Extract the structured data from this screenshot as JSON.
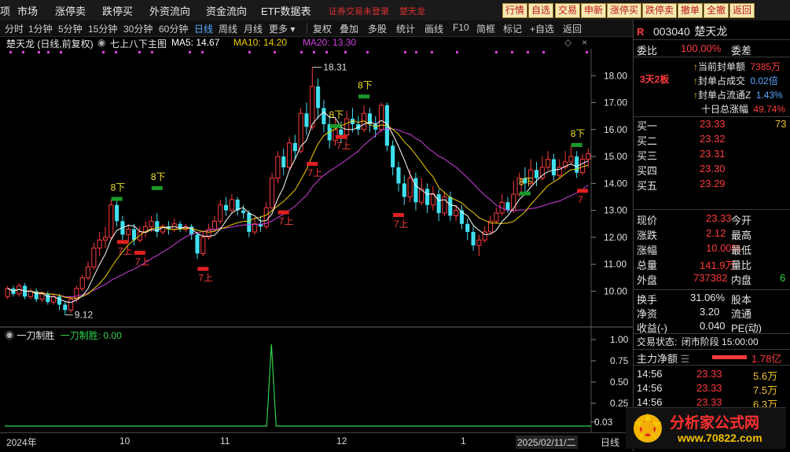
{
  "menu": {
    "items": [
      "项",
      "市场",
      "涨停卖",
      "跌停买",
      "外资流向",
      "资金流向",
      "ETF数据表"
    ],
    "alert": "证券交易未登录",
    "stock_name": "楚天龙",
    "buttons": [
      "行情",
      "自选",
      "交易",
      "申新",
      "涨停买",
      "跌停卖",
      "撤单",
      "全撤",
      "返回"
    ]
  },
  "toolbar": {
    "periods": [
      "分时",
      "1分钟",
      "5分钟",
      "15分钟",
      "30分钟",
      "60分钟",
      "日线",
      "周线",
      "月线",
      "更多"
    ],
    "active_period": "日线",
    "tools": [
      "复权",
      "叠加",
      "多股",
      "统计",
      "画线",
      "F10",
      "简框",
      "标记",
      "+自选",
      "返回"
    ]
  },
  "chart_info": {
    "title": "楚天龙 (日线,前复权)",
    "indicator": "七上八下主图",
    "ma5_label": "MA5: 14.67",
    "ma10_label": "MA10: 14.20",
    "ma20_label": "MA20: 13.30"
  },
  "sub_info": {
    "name": "一刀制胜",
    "value_label": "一刀制胜: 0.00"
  },
  "chart_data": {
    "type": "line",
    "ylim": [
      8.7,
      19.0
    ],
    "yticks": [
      "18.00",
      "17.00",
      "16.00",
      "15.00",
      "14.00",
      "13.00",
      "12.00",
      "11.00",
      "10.00"
    ],
    "sub_yticks": [
      "1.00",
      "0.75",
      "0.50",
      "0.25",
      "0.03"
    ],
    "xlabels": [
      "2024年",
      "10",
      "11",
      "12",
      "1",
      "2025/02/11/二",
      "日线"
    ],
    "high_label": "18.31",
    "low_label": "9.12",
    "marks_down": [
      "8下",
      "8下",
      "8下",
      "8下",
      "8下",
      "8下"
    ],
    "marks_up": [
      "7上",
      "7上",
      "7上",
      "7上",
      "7上",
      "7上",
      "7上",
      "7"
    ],
    "candles": [
      [
        9.8,
        10.1,
        9.7,
        10.2
      ],
      [
        10.1,
        9.9,
        9.8,
        10.2
      ],
      [
        9.9,
        10.2,
        9.8,
        10.3
      ],
      [
        10.2,
        9.8,
        9.7,
        10.3
      ],
      [
        9.8,
        10.0,
        9.7,
        10.1
      ],
      [
        10.0,
        9.7,
        9.6,
        10.1
      ],
      [
        9.7,
        9.9,
        9.6,
        10.0
      ],
      [
        9.9,
        9.6,
        9.5,
        10.0
      ],
      [
        9.6,
        9.8,
        9.5,
        9.9
      ],
      [
        9.8,
        9.5,
        9.3,
        9.9
      ],
      [
        9.5,
        9.3,
        9.12,
        9.6
      ],
      [
        9.3,
        9.7,
        9.2,
        9.8
      ],
      [
        9.7,
        10.1,
        9.6,
        10.2
      ],
      [
        10.1,
        10.5,
        10.0,
        10.6
      ],
      [
        10.5,
        10.9,
        10.4,
        11.1
      ],
      [
        10.9,
        11.6,
        10.8,
        11.8
      ],
      [
        11.6,
        11.9,
        11.3,
        12.2
      ],
      [
        11.9,
        12.0,
        11.6,
        12.4
      ],
      [
        12.0,
        13.2,
        11.9,
        13.4
      ],
      [
        13.2,
        12.6,
        12.4,
        13.4
      ],
      [
        12.6,
        12.1,
        11.9,
        12.8
      ],
      [
        12.1,
        12.3,
        11.8,
        12.5
      ],
      [
        12.3,
        11.9,
        11.7,
        12.5
      ],
      [
        11.9,
        12.2,
        11.8,
        12.4
      ],
      [
        12.2,
        12.4,
        12.0,
        12.6
      ],
      [
        12.4,
        12.6,
        12.2,
        12.8
      ],
      [
        12.6,
        12.2,
        12.0,
        12.9
      ],
      [
        12.2,
        12.4,
        12.1,
        12.5
      ],
      [
        12.4,
        12.3,
        12.1,
        12.6
      ],
      [
        12.3,
        12.5,
        12.2,
        12.7
      ],
      [
        12.5,
        12.3,
        12.2,
        12.6
      ],
      [
        12.3,
        12.4,
        12.2,
        12.5
      ],
      [
        12.4,
        12.1,
        11.9,
        12.5
      ],
      [
        12.1,
        11.4,
        11.2,
        12.2
      ],
      [
        11.4,
        12.0,
        11.3,
        12.2
      ],
      [
        12.0,
        12.3,
        11.9,
        12.5
      ],
      [
        12.3,
        12.6,
        12.2,
        12.8
      ],
      [
        12.6,
        13.2,
        12.5,
        13.4
      ],
      [
        13.2,
        13.0,
        12.8,
        13.5
      ],
      [
        13.0,
        13.4,
        12.9,
        13.6
      ],
      [
        13.4,
        13.0,
        12.8,
        13.5
      ],
      [
        13.0,
        12.9,
        12.7,
        13.2
      ],
      [
        12.9,
        12.2,
        12.0,
        13.0
      ],
      [
        12.2,
        12.5,
        12.1,
        12.7
      ],
      [
        12.5,
        12.4,
        12.2,
        12.8
      ],
      [
        12.4,
        13.1,
        12.3,
        13.3
      ],
      [
        13.1,
        14.2,
        13.0,
        14.4
      ],
      [
        14.2,
        15.0,
        14.0,
        15.2
      ],
      [
        15.0,
        14.6,
        14.3,
        15.3
      ],
      [
        14.6,
        15.5,
        14.5,
        15.7
      ],
      [
        15.5,
        15.2,
        14.9,
        15.8
      ],
      [
        15.2,
        16.6,
        15.1,
        16.8
      ],
      [
        16.6,
        16.1,
        15.8,
        17.0
      ],
      [
        16.1,
        17.6,
        16.0,
        18.31
      ],
      [
        17.6,
        16.8,
        16.4,
        17.9
      ],
      [
        16.8,
        16.2,
        15.9,
        17.1
      ],
      [
        16.2,
        15.6,
        15.3,
        16.5
      ],
      [
        15.6,
        16.0,
        15.4,
        16.4
      ],
      [
        16.0,
        15.8,
        15.5,
        16.3
      ],
      [
        15.8,
        16.4,
        15.6,
        16.7
      ],
      [
        16.4,
        16.2,
        15.9,
        16.8
      ],
      [
        16.2,
        16.0,
        15.8,
        16.5
      ],
      [
        16.0,
        16.6,
        15.9,
        16.9
      ],
      [
        16.6,
        16.2,
        15.9,
        16.8
      ],
      [
        16.2,
        16.0,
        15.7,
        16.5
      ],
      [
        16.0,
        16.9,
        15.9,
        17.0
      ],
      [
        16.9,
        15.4,
        15.2,
        17.0
      ],
      [
        15.4,
        14.6,
        14.3,
        15.6
      ],
      [
        14.6,
        14.0,
        13.7,
        14.8
      ],
      [
        14.0,
        13.5,
        13.2,
        14.3
      ],
      [
        13.5,
        14.2,
        13.3,
        14.5
      ],
      [
        14.2,
        13.3,
        13.0,
        14.4
      ],
      [
        13.3,
        13.8,
        13.2,
        14.2
      ],
      [
        13.8,
        13.2,
        12.9,
        14.0
      ],
      [
        13.2,
        13.6,
        13.0,
        13.9
      ],
      [
        13.6,
        12.9,
        12.6,
        13.8
      ],
      [
        12.9,
        13.5,
        12.8,
        13.7
      ],
      [
        13.5,
        12.8,
        12.6,
        13.7
      ],
      [
        12.8,
        13.0,
        12.6,
        13.2
      ],
      [
        13.0,
        12.5,
        12.3,
        13.2
      ],
      [
        12.5,
        12.2,
        11.9,
        12.7
      ],
      [
        12.2,
        11.7,
        11.5,
        12.4
      ],
      [
        11.7,
        11.9,
        11.3,
        12.1
      ],
      [
        11.9,
        12.2,
        11.8,
        12.4
      ],
      [
        12.2,
        12.6,
        12.1,
        12.8
      ],
      [
        12.6,
        12.9,
        12.5,
        13.1
      ],
      [
        12.9,
        13.3,
        12.8,
        13.6
      ],
      [
        13.3,
        13.0,
        12.9,
        13.5
      ],
      [
        13.0,
        13.6,
        12.9,
        14.1
      ],
      [
        13.6,
        14.2,
        13.5,
        14.4
      ],
      [
        14.2,
        14.0,
        13.7,
        14.6
      ],
      [
        14.0,
        14.5,
        13.9,
        14.9
      ],
      [
        14.5,
        14.2,
        13.9,
        14.8
      ],
      [
        14.2,
        14.6,
        14.1,
        15.0
      ],
      [
        14.6,
        14.9,
        14.5,
        15.2
      ],
      [
        14.9,
        14.3,
        14.1,
        15.1
      ],
      [
        14.3,
        14.6,
        14.2,
        14.9
      ],
      [
        14.6,
        14.8,
        14.5,
        15.2
      ],
      [
        14.8,
        15.0,
        14.7,
        15.4
      ],
      [
        15.0,
        14.4,
        14.2,
        15.2
      ],
      [
        14.4,
        14.9,
        14.3,
        15.1
      ],
      [
        14.9,
        15.1,
        14.6,
        15.3
      ]
    ],
    "ma_colors": {
      "ma5": "#ffffff",
      "ma10": "#f0d000",
      "ma20": "#d040e0"
    },
    "up_color": "#ff3b3b",
    "down_color": "#40e0f0"
  },
  "quote": {
    "code": "003040",
    "name": "楚天龙",
    "ratio_label": "委比",
    "ratio_value": "100.00%",
    "ratio_right": "委差",
    "seal_amount_label": "当前封单额",
    "seal_amount_value": "7385万",
    "seal_ratio_label": "封单占成交",
    "seal_ratio_value": "0.02倍",
    "seal_float_label": "封单占流通Z",
    "seal_float_value": "1.43%",
    "ten_day_label": "十日总涨幅",
    "ten_day_value": "49.74%",
    "board_badge": "3天2板",
    "bids": [
      {
        "label": "买一",
        "price": "23.33",
        "vol": "73"
      },
      {
        "label": "买二",
        "price": "23.32",
        "vol": ""
      },
      {
        "label": "买三",
        "price": "23.31",
        "vol": ""
      },
      {
        "label": "买四",
        "price": "23.30",
        "vol": ""
      },
      {
        "label": "买五",
        "price": "23.29",
        "vol": ""
      }
    ],
    "stats": [
      {
        "l": "现价",
        "v": "23.33",
        "r": "今开"
      },
      {
        "l": "涨跌",
        "v": "2.12",
        "r": "最高"
      },
      {
        "l": "涨幅",
        "v": "10.00%",
        "r": "最低"
      },
      {
        "l": "总量",
        "v": "141.9万",
        "r": "量比"
      },
      {
        "l": "外盘",
        "v": "737382",
        "r": "内盘",
        "r2": "6"
      }
    ],
    "stats2": [
      {
        "l": "换手",
        "v": "31.06%",
        "r": "股本"
      },
      {
        "l": "净资",
        "v": "3.20",
        "r": "流通"
      },
      {
        "l": "收益(-)",
        "v": "0.040",
        "r": "PE(动)"
      }
    ],
    "trade_status_label": "交易状态:",
    "trade_status_value": "闭市阶段 15:00:00",
    "net_amount_label": "主力净额",
    "net_amount_value": "1.78亿",
    "ticks": [
      {
        "t": "14:56",
        "p": "23.33",
        "v": "5.6万"
      },
      {
        "t": "14:56",
        "p": "23.33",
        "v": "7.5万"
      },
      {
        "t": "14:56",
        "p": "23.33",
        "v": "6.3万"
      }
    ]
  },
  "watermark": {
    "text": "分析家公式网",
    "url": "www.70822.com"
  }
}
